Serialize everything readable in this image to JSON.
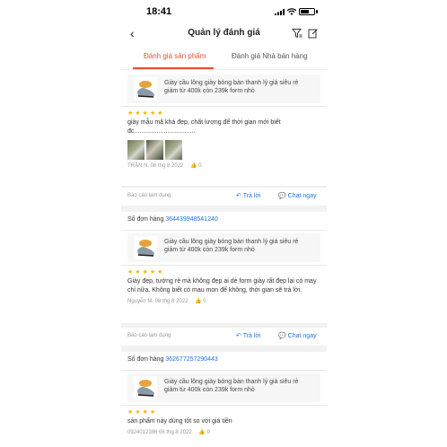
{
  "status": {
    "time": "18:41"
  },
  "header": {
    "title": "Quản lý đánh giá"
  },
  "tabs": [
    {
      "label": "Đánh giá sản phẩm",
      "active": true
    },
    {
      "label": "Đánh giá Nhà bán hàng",
      "active": false
    }
  ],
  "reviews": [
    {
      "order_label": "",
      "order_number": "",
      "product_name": "Giày cầu lông giày bóng bàn thanh lý giá siêu rẻ giảm từ 400k còn 239k form nhỏ",
      "rating": 5,
      "stars": "★★★★★",
      "comment": "giày mẫu mã khá đẹp, chất lượng để thời gian mới biết đc...................................",
      "photo_count": 3,
      "author_date": "TRẦN N. 08 thg 8 2022",
      "likes": "0"
    },
    {
      "order_label": "Số đơn hàng",
      "order_number": "364439948541240",
      "product_name": "Giày cầu lông giày bóng bàn thanh lý giá siêu rẻ giảm từ 400k còn 239k form nhỏ",
      "rating": 5,
      "stars": "★★★★★",
      "comment": "Giày đẹp, tưởng rẻ mà không đẹp ai dè form giày rất đẹp lại có may chỉ nữa. Không biết có mau mon đế không, thời gian sẽ trả lời.",
      "photo_count": 0,
      "author_date": "Nguyễn M. 08 thg 8 2022",
      "likes": "0"
    },
    {
      "order_label": "Số đơn hàng",
      "order_number": "362677257290443",
      "product_name": "Giày cầu lông giày bóng bàn thanh lý giá siêu rẻ giảm từ 400k còn 239k form nhỏ",
      "rating": 4,
      "stars": "★★★★",
      "comment": "sản phẩm này dùng tốt so với giá tiền",
      "photo_count": 0,
      "author_date": "0924012386 06 thg 8 2022",
      "likes": "0"
    }
  ],
  "actions": {
    "report": "Báo cáo lạm dụng",
    "reply": "Trả lời",
    "chat": "Chat ngay"
  },
  "colors": {
    "accent": "#ee4d2d",
    "link": "#2673dd",
    "star": "#f5b800"
  }
}
